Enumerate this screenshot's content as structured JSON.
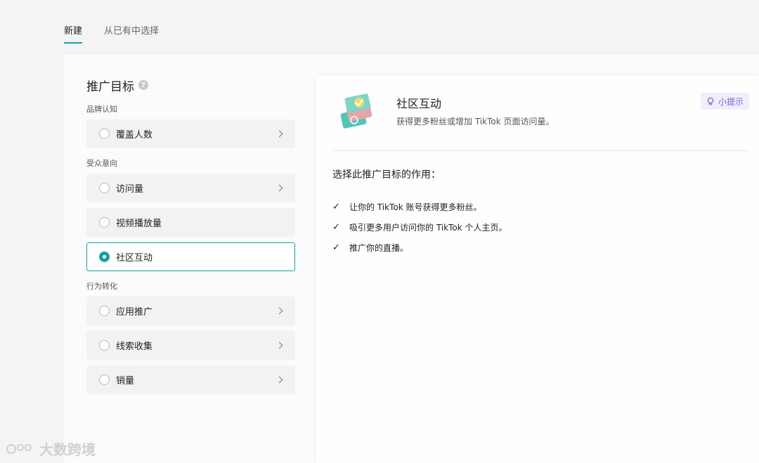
{
  "tabs": [
    {
      "label": "新建",
      "active": true
    },
    {
      "label": "从已有中选择",
      "active": false
    }
  ],
  "objective": {
    "title": "推广目标",
    "help_icon": "question-icon",
    "groups": [
      {
        "label": "品牌认知",
        "options": [
          {
            "label": "覆盖人数",
            "selected": false
          }
        ]
      },
      {
        "label": "受众意向",
        "options": [
          {
            "label": "访问量",
            "selected": false
          },
          {
            "label": "视频播放量",
            "selected": false
          },
          {
            "label": "社区互动",
            "selected": true
          }
        ]
      },
      {
        "label": "行为转化",
        "options": [
          {
            "label": "应用推广",
            "selected": false
          },
          {
            "label": "线索收集",
            "selected": false
          },
          {
            "label": "销量",
            "selected": false
          }
        ]
      }
    ]
  },
  "detail": {
    "title": "社区互动",
    "description": "获得更多粉丝或增加 TikTok 页面访问量。",
    "tip_label": "小提示",
    "purpose_title": "选择此推广目标的作用：",
    "benefits": [
      "让你的 TikTok 账号获得更多粉丝。",
      "吸引更多用户访问你的 TikTok 个人主页。",
      "推广你的直播。"
    ]
  },
  "watermark": "大数跨境",
  "colors": {
    "accent": "#14a39b",
    "tip": "#7a61d6"
  }
}
